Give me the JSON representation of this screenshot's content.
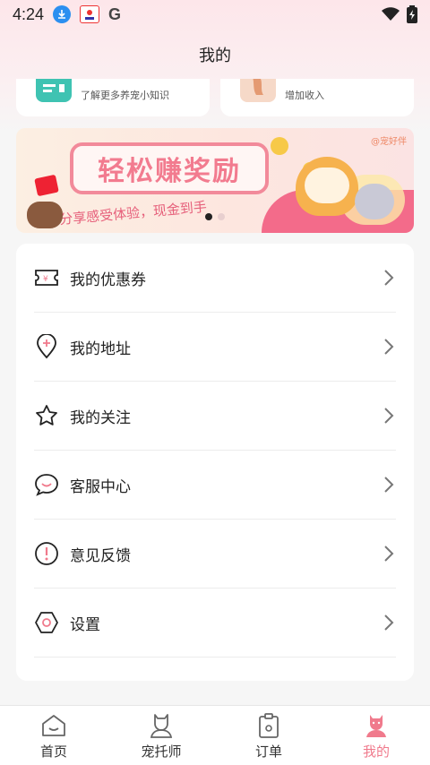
{
  "status_bar": {
    "time": "4:24",
    "google_label": "G"
  },
  "header": {
    "title": "我的"
  },
  "top_cards": [
    {
      "subtitle": "了解更多养宠小知识"
    },
    {
      "subtitle": "增加收入"
    }
  ],
  "banner": {
    "headline": "轻松赚奖励",
    "slogan": "分享感受体验，现金到手",
    "brand": "@宠好伴",
    "slide_count": 2,
    "active_slide": 1
  },
  "menu": {
    "items": [
      {
        "label": "我的优惠券",
        "icon": "coupon-icon"
      },
      {
        "label": "我的地址",
        "icon": "location-pin-icon"
      },
      {
        "label": "我的关注",
        "icon": "star-icon"
      },
      {
        "label": "客服中心",
        "icon": "chat-bubble-icon"
      },
      {
        "label": "意见反馈",
        "icon": "exclamation-icon"
      },
      {
        "label": "设置",
        "icon": "settings-icon"
      }
    ]
  },
  "bottom_nav": {
    "items": [
      {
        "label": "首页",
        "icon": "home-icon"
      },
      {
        "label": "宠托师",
        "icon": "pet-sitter-icon"
      },
      {
        "label": "订单",
        "icon": "order-icon"
      },
      {
        "label": "我的",
        "icon": "profile-icon"
      }
    ],
    "active_index": 3
  },
  "colors": {
    "accent": "#f07a8c",
    "header_gradient_top": "#fde6ea",
    "background": "#f6f6f6"
  }
}
